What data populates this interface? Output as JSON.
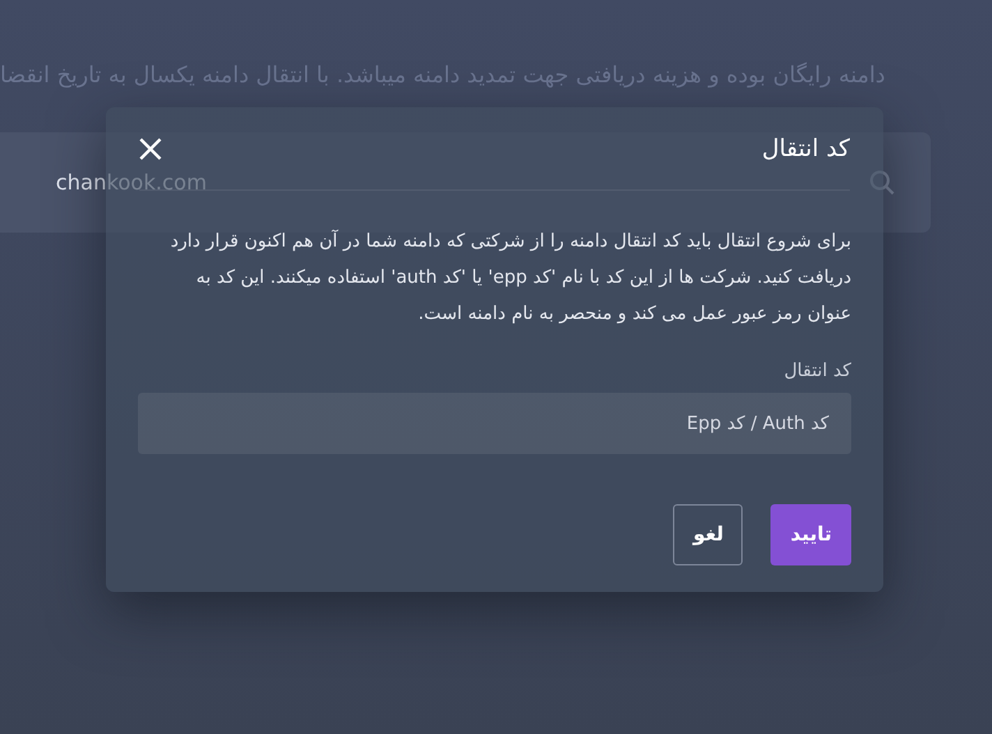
{
  "background": {
    "notice": "دامنه رایگان بوده و هزینه دریافتی جهت تمدید دامنه میباشد. با انتقال دامنه یکسال به تاریخ انقضا",
    "search": {
      "value": "chankook.com"
    }
  },
  "dialog": {
    "title": "کد انتقال",
    "description": "برای شروع انتقال باید کد انتقال دامنه را از شرکتی که دامنه شما در آن هم اکنون قرار دارد دریافت کنید. شرکت ها از این کد با نام 'کد epp' یا 'کد auth' استفاده میکنند. این کد به عنوان رمز عبور عمل می کند و منحصر به نام دامنه است.",
    "field": {
      "label": "کد انتقال",
      "placeholder": "کد Auth / کد Epp"
    },
    "buttons": [
      {
        "label": "تایید",
        "kind": "primary"
      },
      {
        "label": "لغو",
        "kind": "secondary"
      }
    ]
  }
}
